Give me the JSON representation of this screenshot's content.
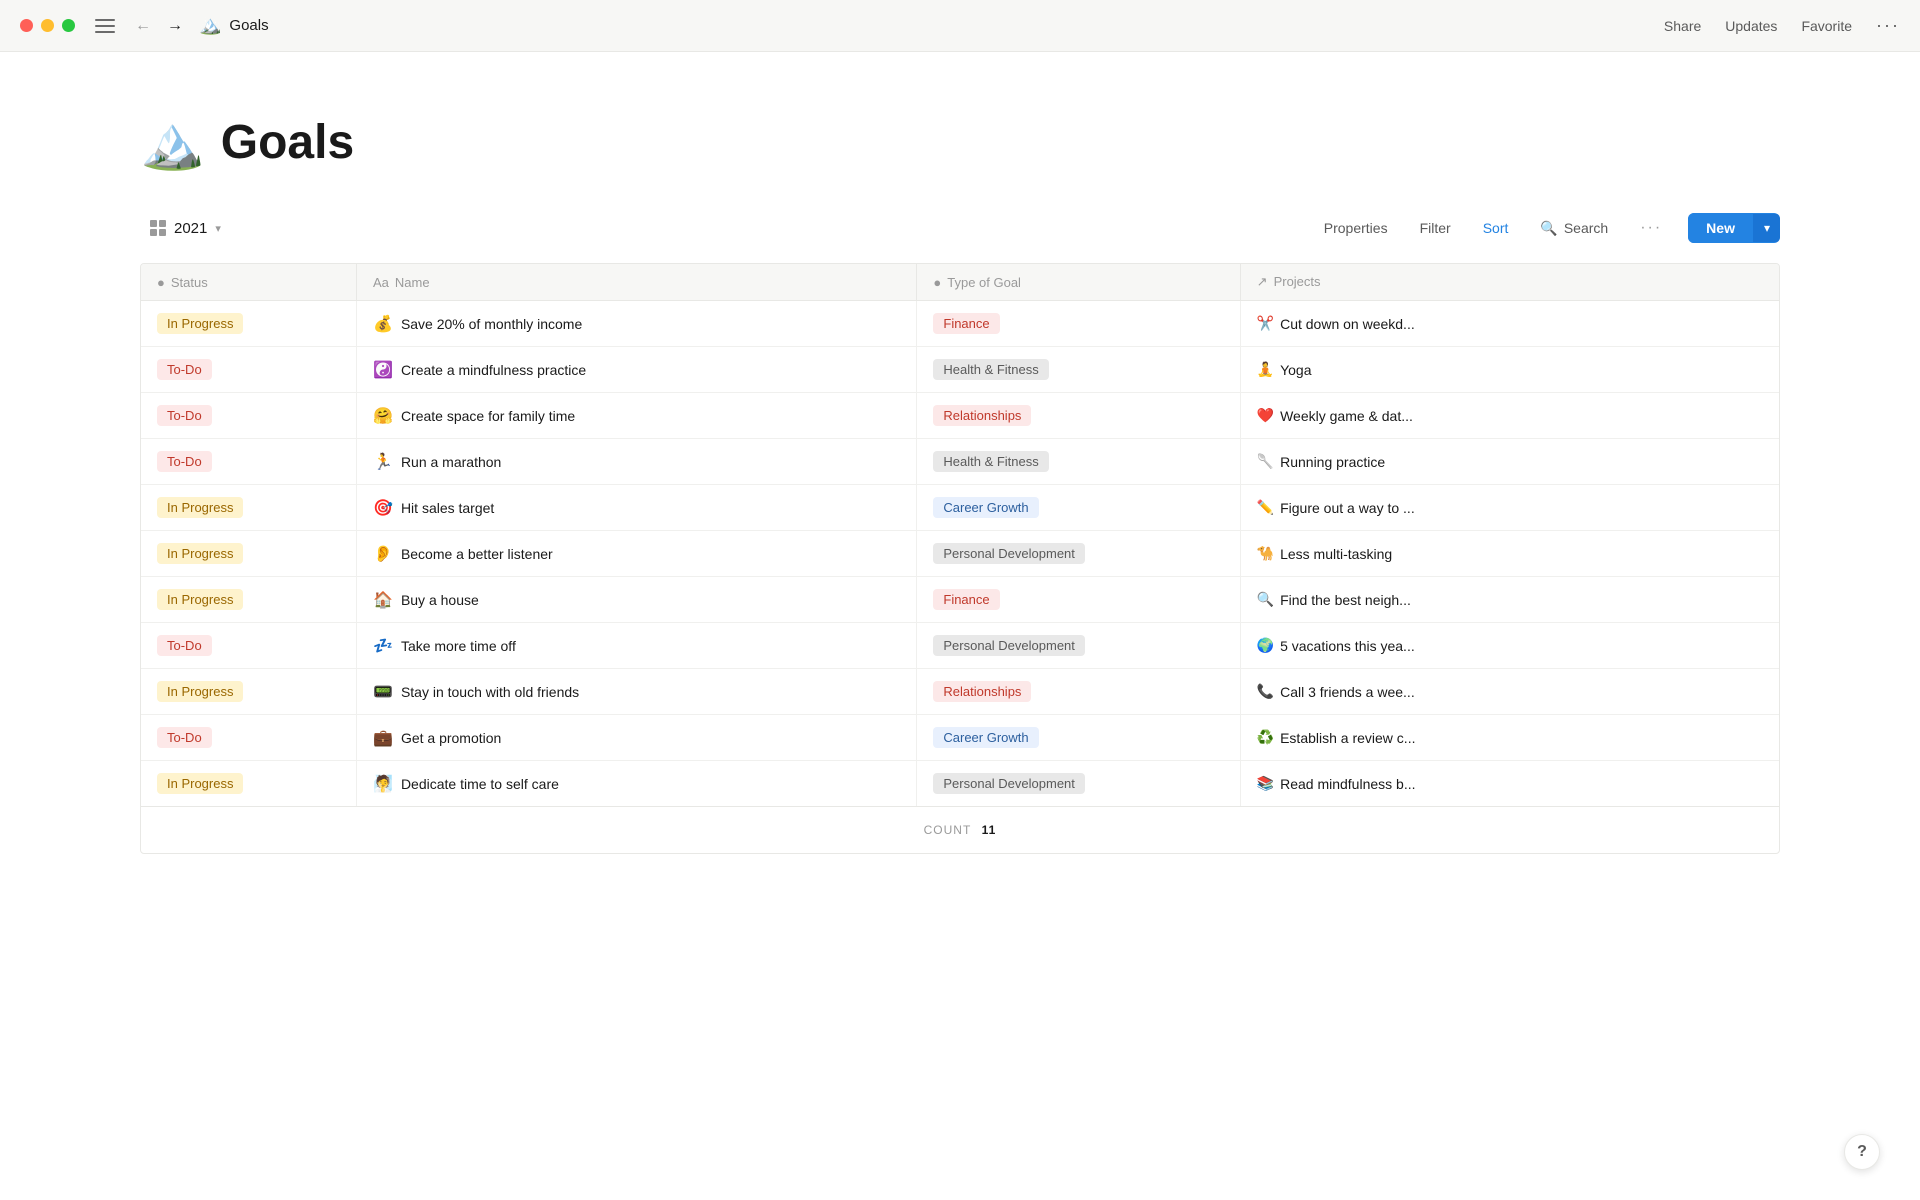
{
  "titleBar": {
    "appName": "Goals",
    "shareLabel": "Share",
    "updatesLabel": "Updates",
    "favoriteLabel": "Favorite"
  },
  "page": {
    "icon": "🏔️",
    "title": "Goals"
  },
  "toolbar": {
    "viewName": "2021",
    "propertiesLabel": "Properties",
    "filterLabel": "Filter",
    "sortLabel": "Sort",
    "searchLabel": "Search",
    "newLabel": "New"
  },
  "columns": [
    {
      "id": "status",
      "icon": "●",
      "label": "Status"
    },
    {
      "id": "name",
      "icon": "Aa",
      "label": "Name"
    },
    {
      "id": "typeofgoal",
      "icon": "●",
      "label": "Type of Goal"
    },
    {
      "id": "projects",
      "icon": "↗",
      "label": "Projects"
    }
  ],
  "rows": [
    {
      "status": "In Progress",
      "statusClass": "badge-in-progress",
      "emoji": "💰",
      "name": "Save 20% of monthly income",
      "goalType": "Finance",
      "goalClass": "goal-finance",
      "projectEmoji": "✂️",
      "project": "Cut down on weekd..."
    },
    {
      "status": "To-Do",
      "statusClass": "badge-to-do",
      "emoji": "☯️",
      "name": "Create a mindfulness practice",
      "goalType": "Health & Fitness",
      "goalClass": "goal-health",
      "projectEmoji": "🧘",
      "project": "Yoga"
    },
    {
      "status": "To-Do",
      "statusClass": "badge-to-do",
      "emoji": "🤗",
      "name": "Create space for family time",
      "goalType": "Relationships",
      "goalClass": "goal-relationships",
      "projectEmoji": "❤️",
      "project": "Weekly game & dat..."
    },
    {
      "status": "To-Do",
      "statusClass": "badge-to-do",
      "emoji": "🏃",
      "name": "Run a marathon",
      "goalType": "Health & Fitness",
      "goalClass": "goal-health",
      "projectEmoji": "🥄",
      "project": "Running practice"
    },
    {
      "status": "In Progress",
      "statusClass": "badge-in-progress",
      "emoji": "🎯",
      "name": "Hit sales target",
      "goalType": "Career Growth",
      "goalClass": "goal-career",
      "projectEmoji": "✏️",
      "project": "Figure out a way to ..."
    },
    {
      "status": "In Progress",
      "statusClass": "badge-in-progress",
      "emoji": "👂",
      "name": "Become a better listener",
      "goalType": "Personal Development",
      "goalClass": "goal-personal",
      "projectEmoji": "🐪",
      "project": "Less multi-tasking"
    },
    {
      "status": "In Progress",
      "statusClass": "badge-in-progress",
      "emoji": "🏠",
      "name": "Buy a house",
      "goalType": "Finance",
      "goalClass": "goal-finance",
      "projectEmoji": "🔍",
      "project": "Find the best neigh..."
    },
    {
      "status": "To-Do",
      "statusClass": "badge-to-do",
      "emoji": "💤",
      "name": "Take more time off",
      "goalType": "Personal Development",
      "goalClass": "goal-personal",
      "projectEmoji": "🌍",
      "project": "5 vacations this yea..."
    },
    {
      "status": "In Progress",
      "statusClass": "badge-in-progress",
      "emoji": "📟",
      "name": "Stay in touch with old friends",
      "goalType": "Relationships",
      "goalClass": "goal-relationships",
      "projectEmoji": "📞",
      "project": "Call 3 friends a wee..."
    },
    {
      "status": "To-Do",
      "statusClass": "badge-to-do",
      "emoji": "💼",
      "name": "Get a promotion",
      "goalType": "Career Growth",
      "goalClass": "goal-career",
      "projectEmoji": "♻️",
      "project": "Establish a review c..."
    },
    {
      "status": "In Progress",
      "statusClass": "badge-in-progress",
      "emoji": "🧖",
      "name": "Dedicate time to self care",
      "goalType": "Personal Development",
      "goalClass": "goal-personal",
      "projectEmoji": "📚",
      "project": "Read mindfulness b..."
    }
  ],
  "footer": {
    "countLabel": "COUNT",
    "count": "11"
  },
  "helpBtn": "?"
}
